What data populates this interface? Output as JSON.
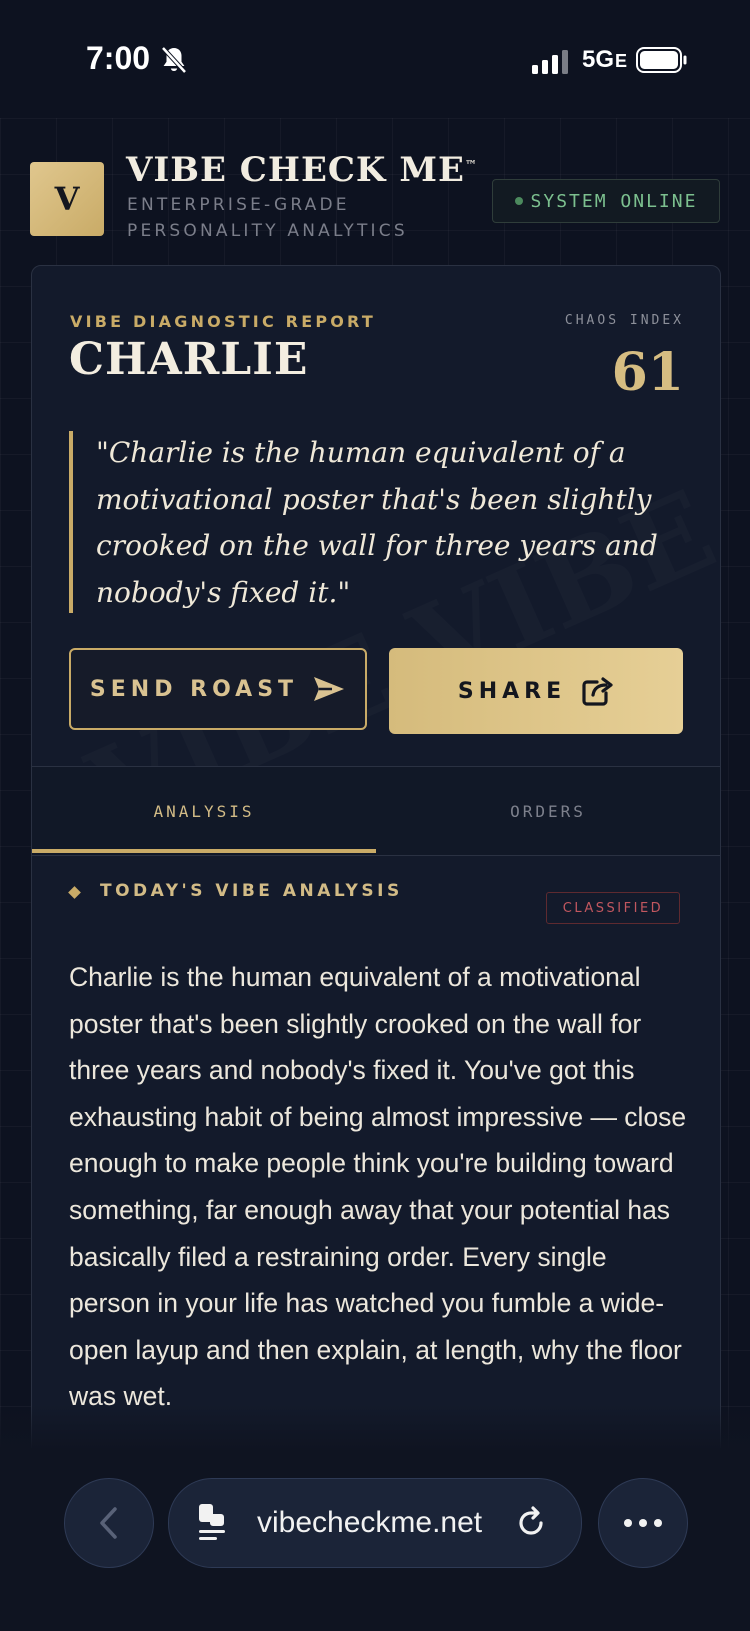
{
  "status_bar": {
    "time": "7:00",
    "network": "5G",
    "network_suffix": "E"
  },
  "header": {
    "logo_letter": "V",
    "brand": "VIBE CHECK ME",
    "trademark": "™",
    "tagline": "ENTERPRISE-GRADE PERSONALITY ANALYTICS",
    "system_status": "SYSTEM ONLINE"
  },
  "report": {
    "label": "VIBE DIAGNOSTIC REPORT",
    "name": "CHARLIE",
    "chaos_label": "CHAOS INDEX",
    "chaos_value": "61",
    "quote": "\"Charlie is the human equivalent of a motivational poster that's been slightly crooked on the wall for three years and nobody's fixed it.\"",
    "send_roast_label": "SEND ROAST",
    "share_label": "SHARE"
  },
  "tabs": [
    {
      "label": "ANALYSIS",
      "active": true
    },
    {
      "label": "ORDERS",
      "active": false
    }
  ],
  "analysis": {
    "title": "TODAY'S VIBE ANALYSIS",
    "badge": "CLASSIFIED",
    "body": "Charlie is the human equivalent of a motivational poster that's been slightly crooked on the wall for three years and nobody's fixed it. You've got this exhausting habit of being almost impressive — close enough to make people think you're building toward something, far enough away that your potential has basically filed a restraining order. Every single person in your life has watched you fumble a wide-open layup and then explain, at length, why the floor was wet."
  },
  "browser": {
    "url": "vibecheckme.net"
  },
  "colors": {
    "gold": "#c9ab67",
    "background": "#0d1220",
    "card": "#131a2b",
    "online_green": "#7cc08f",
    "classified_red": "#c2575f"
  }
}
